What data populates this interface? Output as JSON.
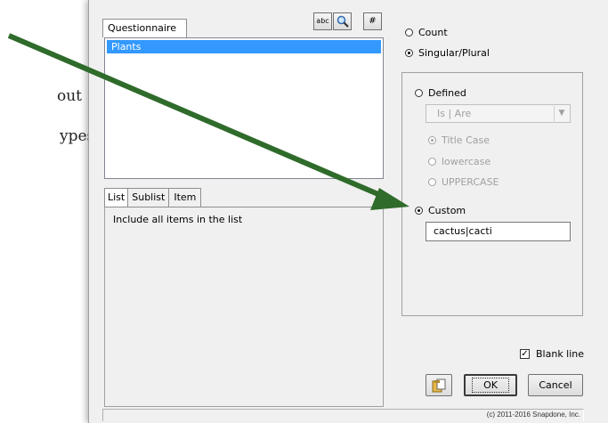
{
  "background": {
    "line1": "out",
    "line2": "ypes."
  },
  "questionnaire": {
    "tab_label": "Questionnaire",
    "items": [
      "Plants"
    ],
    "abc_button": "abc",
    "hash_button": "#"
  },
  "lower_tabs": {
    "list": "List",
    "sublist": "Sublist",
    "item": "Item",
    "content": "Include all items in the list"
  },
  "mode": {
    "count": "Count",
    "singular_plural": "Singular/Plural",
    "selected": "singular_plural"
  },
  "options": {
    "defined": "Defined",
    "defined_value": "Is | Are",
    "title_case": "Title Case",
    "lowercase": "lowercase",
    "uppercase": "UPPERCASE",
    "custom": "Custom",
    "custom_value": "cactus|cacti",
    "selected": "custom"
  },
  "blank_line": {
    "label": "Blank line",
    "checked": true
  },
  "buttons": {
    "ok": "OK",
    "cancel": "Cancel"
  },
  "footer": {
    "copyright": "(c) 2011-2016 Snapdone, Inc."
  },
  "colors": {
    "arrow": "#2f6b2a",
    "selection": "#3399ff",
    "dialog_bg": "#f0f0f0"
  }
}
